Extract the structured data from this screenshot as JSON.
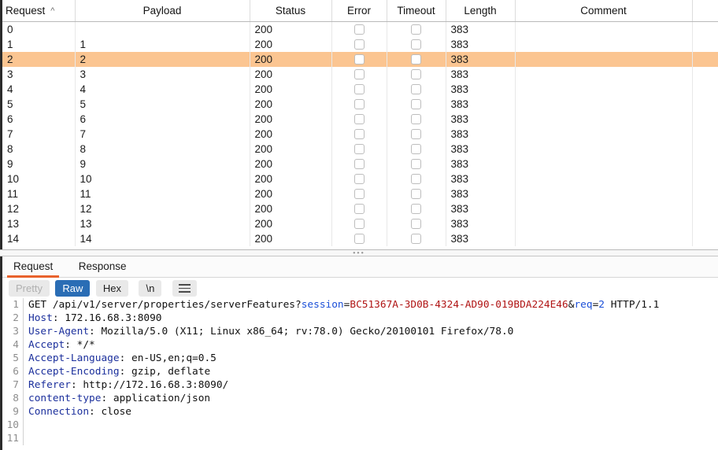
{
  "colors": {
    "selection": "#fbc591",
    "tab_accent": "#e8622c",
    "active_button": "#2a6db5",
    "header_name": "#1b2f9c",
    "param_name": "#1b4fd8",
    "param_value": "#b01414"
  },
  "results_table": {
    "columns": [
      {
        "label": "Request",
        "sorted": true,
        "sort_icon": "sort-ascending-caret"
      },
      {
        "label": "Payload",
        "sorted": false
      },
      {
        "label": "Status",
        "sorted": false
      },
      {
        "label": "Error",
        "sorted": false
      },
      {
        "label": "Timeout",
        "sorted": false
      },
      {
        "label": "Length",
        "sorted": false
      },
      {
        "label": "Comment",
        "sorted": false
      },
      {
        "label": "",
        "sorted": false
      }
    ],
    "selected_row_index": 2,
    "rows": [
      {
        "request": "0",
        "payload": "",
        "status": "200",
        "error": false,
        "timeout": false,
        "length": "383",
        "comment": ""
      },
      {
        "request": "1",
        "payload": "1",
        "status": "200",
        "error": false,
        "timeout": false,
        "length": "383",
        "comment": ""
      },
      {
        "request": "2",
        "payload": "2",
        "status": "200",
        "error": false,
        "timeout": false,
        "length": "383",
        "comment": ""
      },
      {
        "request": "3",
        "payload": "3",
        "status": "200",
        "error": false,
        "timeout": false,
        "length": "383",
        "comment": ""
      },
      {
        "request": "4",
        "payload": "4",
        "status": "200",
        "error": false,
        "timeout": false,
        "length": "383",
        "comment": ""
      },
      {
        "request": "5",
        "payload": "5",
        "status": "200",
        "error": false,
        "timeout": false,
        "length": "383",
        "comment": ""
      },
      {
        "request": "6",
        "payload": "6",
        "status": "200",
        "error": false,
        "timeout": false,
        "length": "383",
        "comment": ""
      },
      {
        "request": "7",
        "payload": "7",
        "status": "200",
        "error": false,
        "timeout": false,
        "length": "383",
        "comment": ""
      },
      {
        "request": "8",
        "payload": "8",
        "status": "200",
        "error": false,
        "timeout": false,
        "length": "383",
        "comment": ""
      },
      {
        "request": "9",
        "payload": "9",
        "status": "200",
        "error": false,
        "timeout": false,
        "length": "383",
        "comment": ""
      },
      {
        "request": "10",
        "payload": "10",
        "status": "200",
        "error": false,
        "timeout": false,
        "length": "383",
        "comment": ""
      },
      {
        "request": "11",
        "payload": "11",
        "status": "200",
        "error": false,
        "timeout": false,
        "length": "383",
        "comment": ""
      },
      {
        "request": "12",
        "payload": "12",
        "status": "200",
        "error": false,
        "timeout": false,
        "length": "383",
        "comment": ""
      },
      {
        "request": "13",
        "payload": "13",
        "status": "200",
        "error": false,
        "timeout": false,
        "length": "383",
        "comment": ""
      },
      {
        "request": "14",
        "payload": "14",
        "status": "200",
        "error": false,
        "timeout": false,
        "length": "383",
        "comment": ""
      }
    ]
  },
  "splitter": {
    "grip_glyph": "•••"
  },
  "message_tabs": {
    "items": [
      {
        "label": "Request",
        "active": true
      },
      {
        "label": "Response",
        "active": false
      }
    ]
  },
  "format_bar": {
    "buttons": [
      {
        "label": "Pretty",
        "state": "disabled"
      },
      {
        "label": "Raw",
        "state": "active"
      },
      {
        "label": "Hex",
        "state": "normal"
      },
      {
        "label": "\\n",
        "state": "normal"
      },
      {
        "label": "",
        "state": "normal",
        "icon": "hamburger-menu-icon"
      }
    ]
  },
  "code_view": {
    "cursor_line": 11,
    "lines": [
      {
        "n": "1",
        "segments": [
          {
            "t": "GET /api/v1/server/properties/serverFeatures?",
            "c": "plain"
          },
          {
            "t": "session",
            "c": "param"
          },
          {
            "t": "=",
            "c": "plain"
          },
          {
            "t": "BC51367A-3D0B-4324-AD90-019BDA224E46",
            "c": "value"
          },
          {
            "t": "&",
            "c": "plain"
          },
          {
            "t": "req",
            "c": "param"
          },
          {
            "t": "=",
            "c": "plain"
          },
          {
            "t": "2",
            "c": "num"
          },
          {
            "t": " HTTP/1.1",
            "c": "plain"
          }
        ]
      },
      {
        "n": "2",
        "segments": [
          {
            "t": "Host",
            "c": "hdr"
          },
          {
            "t": ": 172.16.68.3:8090",
            "c": "plain"
          }
        ]
      },
      {
        "n": "3",
        "segments": [
          {
            "t": "User-Agent",
            "c": "hdr"
          },
          {
            "t": ": Mozilla/5.0 (X11; Linux x86_64; rv:78.0) Gecko/20100101 Firefox/78.0",
            "c": "plain"
          }
        ]
      },
      {
        "n": "4",
        "segments": [
          {
            "t": "Accept",
            "c": "hdr"
          },
          {
            "t": ": */*",
            "c": "plain"
          }
        ]
      },
      {
        "n": "5",
        "segments": [
          {
            "t": "Accept-Language",
            "c": "hdr"
          },
          {
            "t": ": en-US,en;q=0.5",
            "c": "plain"
          }
        ]
      },
      {
        "n": "6",
        "segments": [
          {
            "t": "Accept-Encoding",
            "c": "hdr"
          },
          {
            "t": ": gzip, deflate",
            "c": "plain"
          }
        ]
      },
      {
        "n": "7",
        "segments": [
          {
            "t": "Referer",
            "c": "hdr"
          },
          {
            "t": ": http://172.16.68.3:8090/",
            "c": "plain"
          }
        ]
      },
      {
        "n": "8",
        "segments": [
          {
            "t": "content-type",
            "c": "hdr"
          },
          {
            "t": ": application/json",
            "c": "plain"
          }
        ]
      },
      {
        "n": "9",
        "segments": [
          {
            "t": "Connection",
            "c": "hdr"
          },
          {
            "t": ": close",
            "c": "plain"
          }
        ]
      },
      {
        "n": "10",
        "segments": []
      },
      {
        "n": "11",
        "segments": []
      }
    ]
  }
}
